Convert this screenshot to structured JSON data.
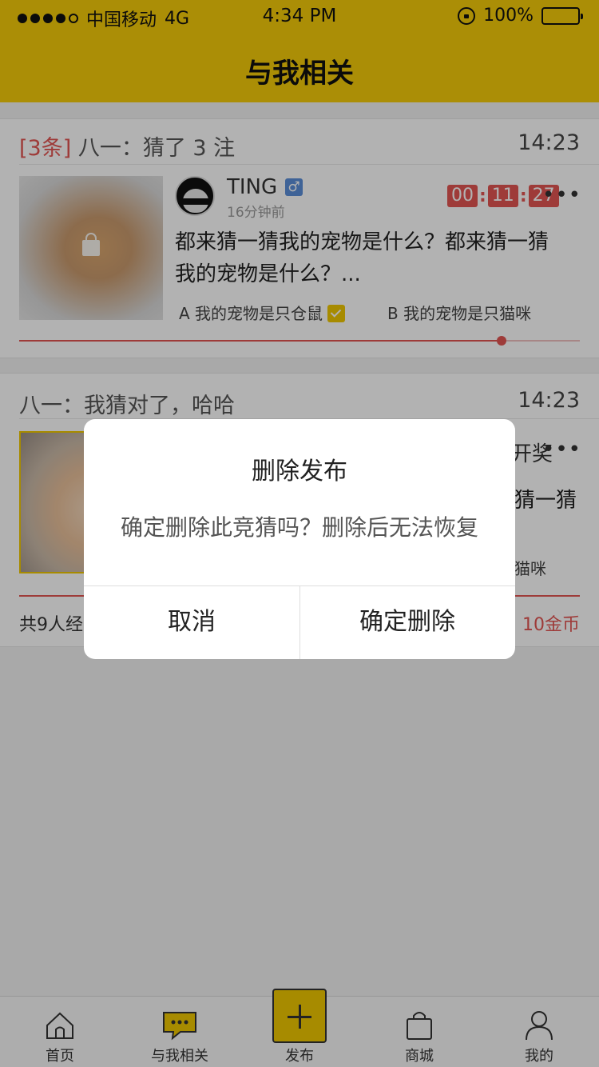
{
  "status_bar": {
    "carrier": "中国移动",
    "network": "4G",
    "time": "4:34 PM",
    "battery": "100%"
  },
  "nav": {
    "title": "与我相关"
  },
  "card1": {
    "tag": "[3条]",
    "headline": " 八一：猜了 3 注",
    "time": "14:23",
    "username": "TING",
    "gender_symbol": "♂",
    "posted": "16分钟前",
    "countdown": {
      "h": "00",
      "m": "11",
      "s": "27"
    },
    "more": "•••",
    "question_line1": "都来猜一猜我的宠物是什么？都来猜一猜",
    "question_line2": "我的宠物是什么？...",
    "option_a": "A 我的宠物是只仓鼠",
    "option_b": "B 我的宠物是只猫咪",
    "progress": 0.86
  },
  "card2": {
    "headline": "八一：我猜对了，哈哈",
    "time": "14:23",
    "partial_right_top": "开奖",
    "more": "•••",
    "partial_question": "猜一猜",
    "partial_option": "猫咪",
    "footer_left": "共9人经",
    "footer_right": "10金币"
  },
  "dialog": {
    "title": "删除发布",
    "message": "确定删除此竞猜吗？删除后无法恢复",
    "cancel": "取消",
    "confirm": "确定删除"
  },
  "tabbar": {
    "home": "首页",
    "related": "与我相关",
    "publish": "发布",
    "mall": "商城",
    "mine": "我的"
  },
  "colors": {
    "accent": "#f5cc0a",
    "red": "#e25552",
    "gender_blue": "#5b8ed8"
  }
}
